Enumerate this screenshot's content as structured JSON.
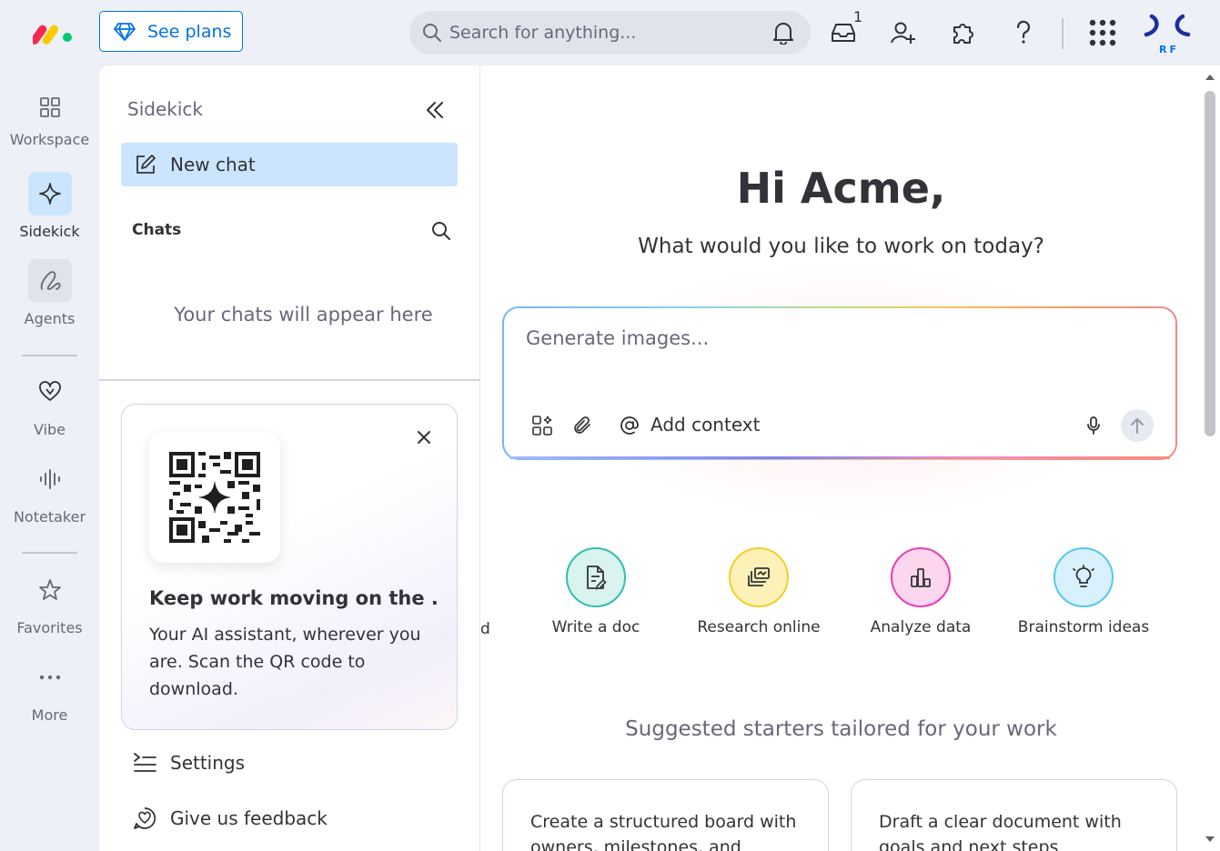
{
  "topbar": {
    "see_plans_label": "See plans",
    "search_placeholder": "Search for anything...",
    "inbox_count": "1",
    "avatar_initials": "RF"
  },
  "rail": {
    "items": [
      {
        "label": "Workspace",
        "icon": "workspace-grid-icon"
      },
      {
        "label": "Sidekick",
        "icon": "sparkle-icon"
      },
      {
        "label": "Agents",
        "icon": "agents-icon"
      },
      {
        "label": "Vibe",
        "icon": "vibe-heart-icon"
      },
      {
        "label": "Notetaker",
        "icon": "audio-wave-icon"
      },
      {
        "label": "Favorites",
        "icon": "star-icon"
      },
      {
        "label": "More",
        "icon": "more-dots-icon"
      }
    ]
  },
  "panel": {
    "title": "Sidekick",
    "new_chat_label": "New chat",
    "chats_label": "Chats",
    "chats_empty": "Your chats will appear here",
    "promo_title": "Keep work moving on the ...",
    "promo_body": "Your AI assistant, wherever you are. Scan the QR code to download.",
    "settings_label": "Settings",
    "feedback_label": "Give us feedback"
  },
  "main": {
    "greeting": "Hi Acme,",
    "subtitle": "What would you like to work on today?",
    "composer_placeholder": "Generate images...",
    "add_context_label": "Add context",
    "cut_off_label": "d",
    "actions": [
      {
        "label": "Write a doc",
        "color": "#2fbfae",
        "bg": "#d9f4ef"
      },
      {
        "label": "Research online",
        "color": "#f2cf2a",
        "bg": "#fdf1b8"
      },
      {
        "label": "Analyze data",
        "color": "#e93fb4",
        "bg": "#fbd6ee"
      },
      {
        "label": "Brainstorm ideas",
        "color": "#55c8f0",
        "bg": "#d8f1fc"
      }
    ],
    "suggested_title": "Suggested starters tailored for your work",
    "starters": [
      {
        "text": "Create a structured board with owners, milestones, and"
      },
      {
        "text": "Draft a clear document with goals and next steps"
      }
    ]
  },
  "colors": {
    "accent": "#0073ea",
    "selected_bg": "#cce5ff",
    "app_bg": "#eef0f7"
  }
}
